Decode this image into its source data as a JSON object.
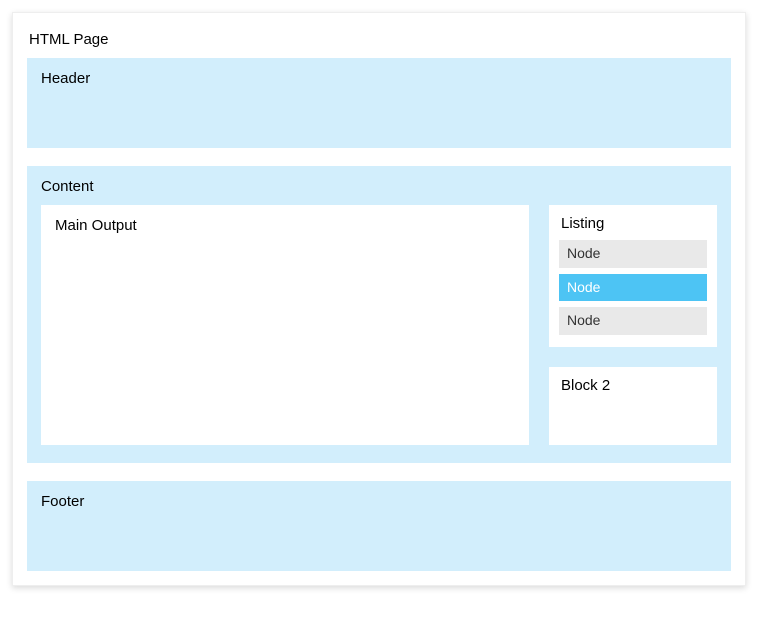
{
  "page_title": "HTML Page",
  "header": {
    "label": "Header"
  },
  "content": {
    "label": "Content",
    "main_output": {
      "label": "Main Output"
    },
    "listing": {
      "label": "Listing",
      "items": [
        {
          "label": "Node",
          "selected": false
        },
        {
          "label": "Node",
          "selected": true
        },
        {
          "label": "Node",
          "selected": false
        }
      ]
    },
    "block2": {
      "label": "Block 2"
    }
  },
  "footer": {
    "label": "Footer"
  }
}
